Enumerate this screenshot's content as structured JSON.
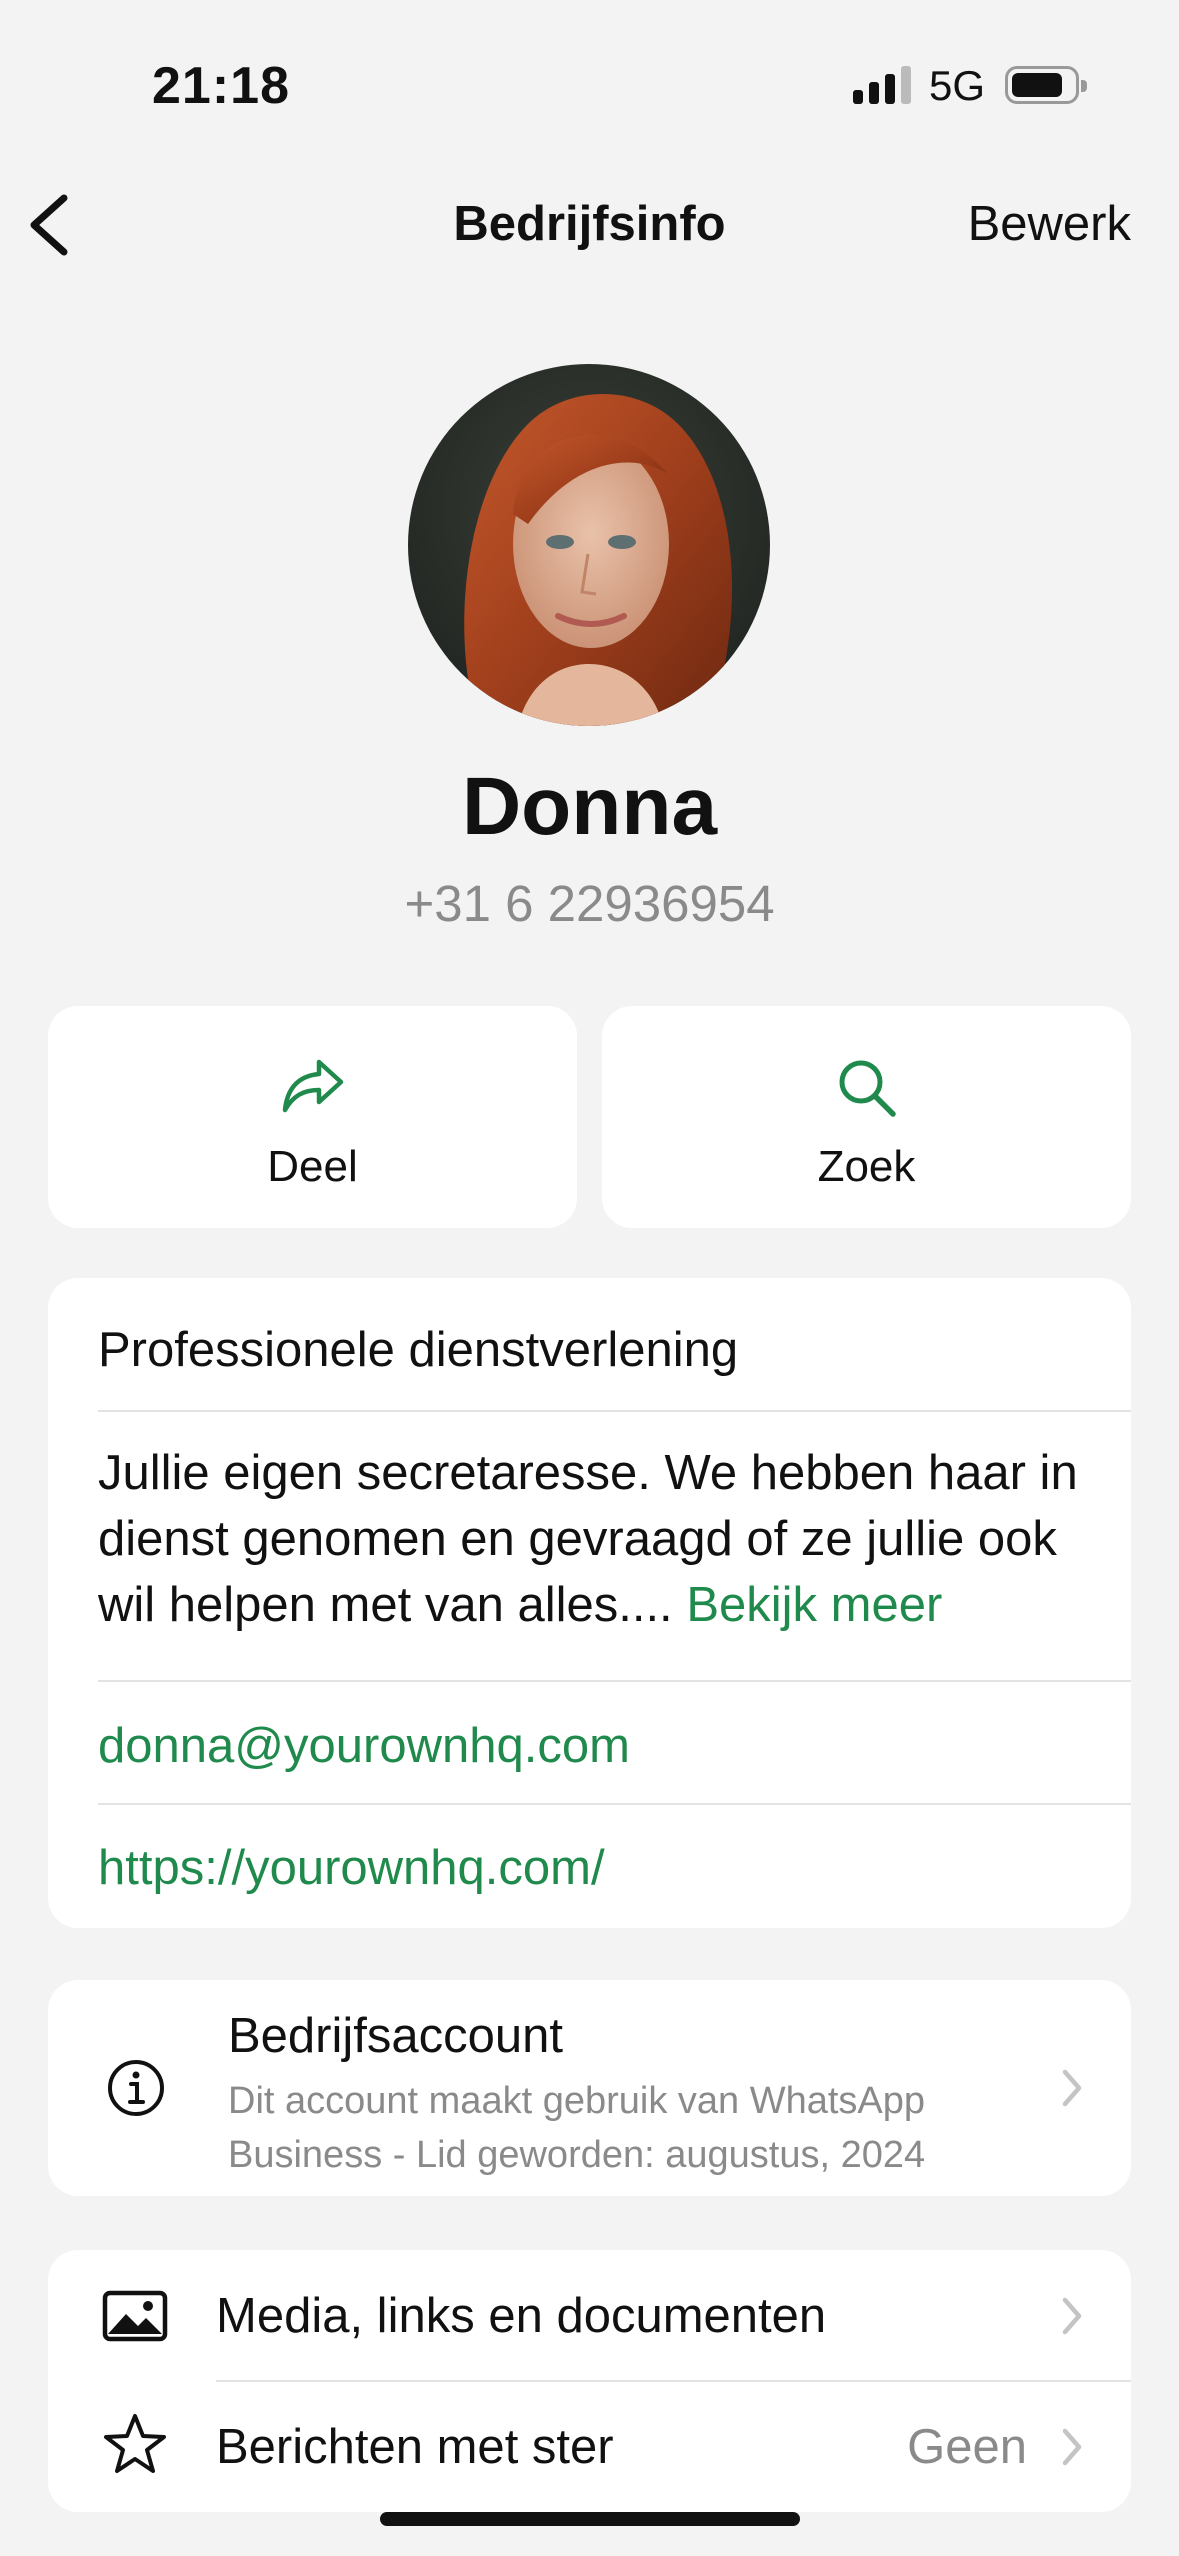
{
  "status_bar": {
    "time": "21:18",
    "network": "5G"
  },
  "nav": {
    "title": "Bedrijfsinfo",
    "edit": "Bewerk",
    "back_icon": "chevron-left-icon"
  },
  "profile": {
    "name": "Donna",
    "phone": "+31 6 22936954",
    "avatar_icon": "profile-photo"
  },
  "actions": [
    {
      "label": "Deel",
      "icon": "share-arrow-icon"
    },
    {
      "label": "Zoek",
      "icon": "search-icon"
    }
  ],
  "info": {
    "category": "Professionele dienstverlening",
    "description": "Jullie eigen secretaresse. We hebben haar in dienst genomen en gevraagd of ze jullie ook wil helpen met van alles....",
    "see_more": "Bekijk meer",
    "email": "donna@yourownhq.com",
    "website": "https://yourownhq.com/"
  },
  "business_account": {
    "title": "Bedrijfsaccount",
    "subtitle_line1": "Dit account maakt gebruik van WhatsApp",
    "subtitle_line2": "Business - Lid geworden: augustus, 2024",
    "icon": "info-icon"
  },
  "media_rows": [
    {
      "label": "Media, links en documenten",
      "icon": "image-icon"
    },
    {
      "label": "Berichten met ster",
      "value": "Geen",
      "icon": "star-icon"
    }
  ],
  "colors": {
    "accent": "#1f8a4c",
    "background": "#f3f3f3",
    "secondary_text": "#8a8a8a"
  }
}
